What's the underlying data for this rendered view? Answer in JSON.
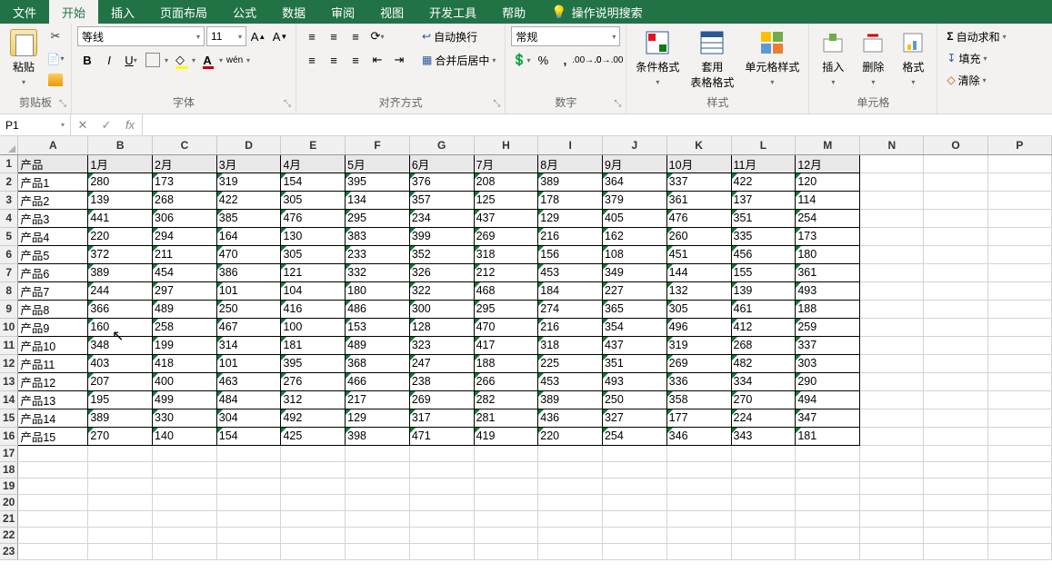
{
  "tabs": [
    "文件",
    "开始",
    "插入",
    "页面布局",
    "公式",
    "数据",
    "审阅",
    "视图",
    "开发工具",
    "帮助"
  ],
  "tellMe": "操作说明搜索",
  "ribbon": {
    "clipboard": {
      "label": "剪贴板",
      "paste": "粘贴"
    },
    "font": {
      "label": "字体",
      "name": "等线",
      "size": "11"
    },
    "align": {
      "label": "对齐方式",
      "wrap": "自动换行",
      "merge": "合并后居中"
    },
    "number": {
      "label": "数字",
      "format": "常规"
    },
    "styles": {
      "label": "样式",
      "cond": "条件格式",
      "table": "套用\n表格格式",
      "cell": "单元格样式"
    },
    "cells": {
      "label": "单元格",
      "insert": "插入",
      "delete": "删除",
      "format": "格式"
    },
    "editing": {
      "sum": "自动求和",
      "fill": "填充",
      "clear": "清除"
    }
  },
  "nameBox": "P1",
  "columns": [
    "A",
    "B",
    "C",
    "D",
    "E",
    "F",
    "G",
    "H",
    "I",
    "J",
    "K",
    "L",
    "M",
    "N",
    "O",
    "P"
  ],
  "headerRow": [
    "产品",
    "1月",
    "2月",
    "3月",
    "4月",
    "5月",
    "6月",
    "7月",
    "8月",
    "9月",
    "10月",
    "11月",
    "12月"
  ],
  "chart_data": {
    "type": "table",
    "rows": [
      [
        "产品1",
        "280",
        "173",
        "319",
        "154",
        "395",
        "376",
        "208",
        "389",
        "364",
        "337",
        "422",
        "120"
      ],
      [
        "产品2",
        "139",
        "268",
        "422",
        "305",
        "134",
        "357",
        "125",
        "178",
        "379",
        "361",
        "137",
        "114"
      ],
      [
        "产品3",
        "441",
        "306",
        "385",
        "476",
        "295",
        "234",
        "437",
        "129",
        "405",
        "476",
        "351",
        "254"
      ],
      [
        "产品4",
        "220",
        "294",
        "164",
        "130",
        "383",
        "399",
        "269",
        "216",
        "162",
        "260",
        "335",
        "173"
      ],
      [
        "产品5",
        "372",
        "211",
        "470",
        "305",
        "233",
        "352",
        "318",
        "156",
        "108",
        "451",
        "456",
        "180"
      ],
      [
        "产品6",
        "389",
        "454",
        "386",
        "121",
        "332",
        "326",
        "212",
        "453",
        "349",
        "144",
        "155",
        "361"
      ],
      [
        "产品7",
        "244",
        "297",
        "101",
        "104",
        "180",
        "322",
        "468",
        "184",
        "227",
        "132",
        "139",
        "493"
      ],
      [
        "产品8",
        "366",
        "489",
        "250",
        "416",
        "486",
        "300",
        "295",
        "274",
        "365",
        "305",
        "461",
        "188"
      ],
      [
        "产品9",
        "160",
        "258",
        "467",
        "100",
        "153",
        "128",
        "470",
        "216",
        "354",
        "496",
        "412",
        "259"
      ],
      [
        "产品10",
        "348",
        "199",
        "314",
        "181",
        "489",
        "323",
        "417",
        "318",
        "437",
        "319",
        "268",
        "337"
      ],
      [
        "产品11",
        "403",
        "418",
        "101",
        "395",
        "368",
        "247",
        "188",
        "225",
        "351",
        "269",
        "482",
        "303"
      ],
      [
        "产品12",
        "207",
        "400",
        "463",
        "276",
        "466",
        "238",
        "266",
        "453",
        "493",
        "336",
        "334",
        "290"
      ],
      [
        "产品13",
        "195",
        "499",
        "484",
        "312",
        "217",
        "269",
        "282",
        "389",
        "250",
        "358",
        "270",
        "494"
      ],
      [
        "产品14",
        "389",
        "330",
        "304",
        "492",
        "129",
        "317",
        "281",
        "436",
        "327",
        "177",
        "224",
        "347"
      ],
      [
        "产品15",
        "270",
        "140",
        "154",
        "425",
        "398",
        "471",
        "419",
        "220",
        "254",
        "346",
        "343",
        "181"
      ]
    ]
  },
  "totalRows": 23
}
